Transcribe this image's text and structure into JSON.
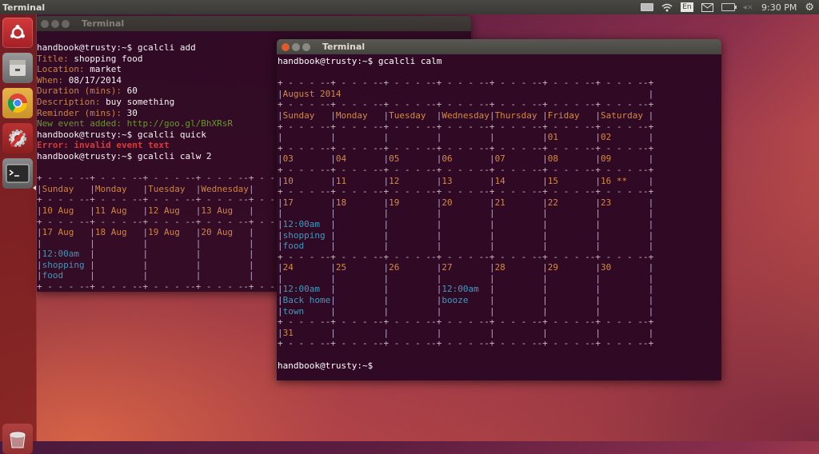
{
  "top_panel": {
    "app_title": "Terminal",
    "indicators": {
      "keyboard": "keyboard-icon",
      "wifi": "wifi-icon",
      "language": "En",
      "mail": "mail-icon",
      "battery": "battery-icon",
      "volume": "volume-muted-icon",
      "clock": "9:30 PM",
      "session": "gear-icon"
    }
  },
  "launcher": {
    "items": [
      {
        "name": "Ubuntu Dash",
        "icon": "ubuntu-logo-icon"
      },
      {
        "name": "Files",
        "icon": "file-cabinet-icon"
      },
      {
        "name": "Chrome",
        "icon": "chrome-icon"
      },
      {
        "name": "System Settings",
        "icon": "settings-icon"
      },
      {
        "name": "Terminal",
        "icon": "terminal-icon",
        "active": true
      },
      {
        "name": "Trash",
        "icon": "trash-icon"
      }
    ]
  },
  "colors": {
    "terminal_bg": "#300a24",
    "label": "#d38a43",
    "event": "#3e9ac0",
    "success": "#6a9e2a",
    "error": "#e03a3a"
  },
  "back_terminal": {
    "title": "Terminal",
    "prompt": "handbook@trusty:~$",
    "lines": [
      {
        "type": "cmd",
        "text": "gcalcli add"
      },
      {
        "type": "field",
        "label": "Title:",
        "value": "shopping food"
      },
      {
        "type": "field",
        "label": "Location:",
        "value": "market"
      },
      {
        "type": "field",
        "label": "When:",
        "value": "08/17/2014"
      },
      {
        "type": "field",
        "label": "Duration (mins):",
        "value": "60"
      },
      {
        "type": "field",
        "label": "Description:",
        "value": "buy something"
      },
      {
        "type": "field",
        "label": "Reminder (mins):",
        "value": "30"
      },
      {
        "type": "success",
        "text": "New event added: http://goo.gl/BhXRsR"
      },
      {
        "type": "cmd",
        "text": "gcalcli quick"
      },
      {
        "type": "error",
        "text": "Error: invalid event text"
      },
      {
        "type": "cmd",
        "text": "gcalcli calw 2"
      }
    ],
    "week_calendar": {
      "days": [
        "Sunday",
        "Monday",
        "Tuesday",
        "Wednesday"
      ],
      "weeks": [
        {
          "dates": [
            "10 Aug",
            "11 Aug",
            "12 Aug",
            "13 Aug"
          ],
          "events": [
            [],
            [],
            [],
            []
          ]
        },
        {
          "dates": [
            "17 Aug",
            "18 Aug",
            "19 Aug",
            "20 Aug"
          ],
          "events": [
            [
              "12:00am",
              "shopping",
              "food"
            ],
            [],
            [],
            []
          ]
        }
      ]
    }
  },
  "front_terminal": {
    "title": "Terminal",
    "prompt": "handbook@trusty:~$",
    "command": "gcalcli calm",
    "month_title": "August 2014",
    "days": [
      "Sunday",
      "Monday",
      "Tuesday",
      "Wednesday",
      "Thursday",
      "Friday",
      "Saturday"
    ],
    "weeks": [
      {
        "dates": [
          "",
          "",
          "",
          "",
          "",
          "01",
          "02"
        ],
        "events": [
          [],
          [],
          [],
          [],
          [],
          [],
          []
        ]
      },
      {
        "dates": [
          "03",
          "04",
          "05",
          "06",
          "07",
          "08",
          "09"
        ],
        "events": [
          [],
          [],
          [],
          [],
          [],
          [],
          []
        ]
      },
      {
        "dates": [
          "10",
          "11",
          "12",
          "13",
          "14",
          "15",
          "16 **"
        ],
        "events": [
          [],
          [],
          [],
          [],
          [],
          [],
          []
        ]
      },
      {
        "dates": [
          "17",
          "18",
          "19",
          "20",
          "21",
          "22",
          "23"
        ],
        "events": [
          [
            "12:00am",
            "shopping",
            "food"
          ],
          [],
          [],
          [],
          [],
          [],
          []
        ]
      },
      {
        "dates": [
          "24",
          "25",
          "26",
          "27",
          "28",
          "29",
          "30"
        ],
        "events": [
          [
            "12:00am",
            "Back home",
            "town"
          ],
          [],
          [],
          [
            "12:00am",
            "booze"
          ],
          [],
          [],
          []
        ]
      },
      {
        "dates": [
          "31",
          "",
          "",
          "",
          "",
          "",
          ""
        ],
        "events": [
          [],
          [],
          [],
          [],
          [],
          [],
          []
        ]
      }
    ],
    "final_prompt": "handbook@trusty:~$"
  }
}
